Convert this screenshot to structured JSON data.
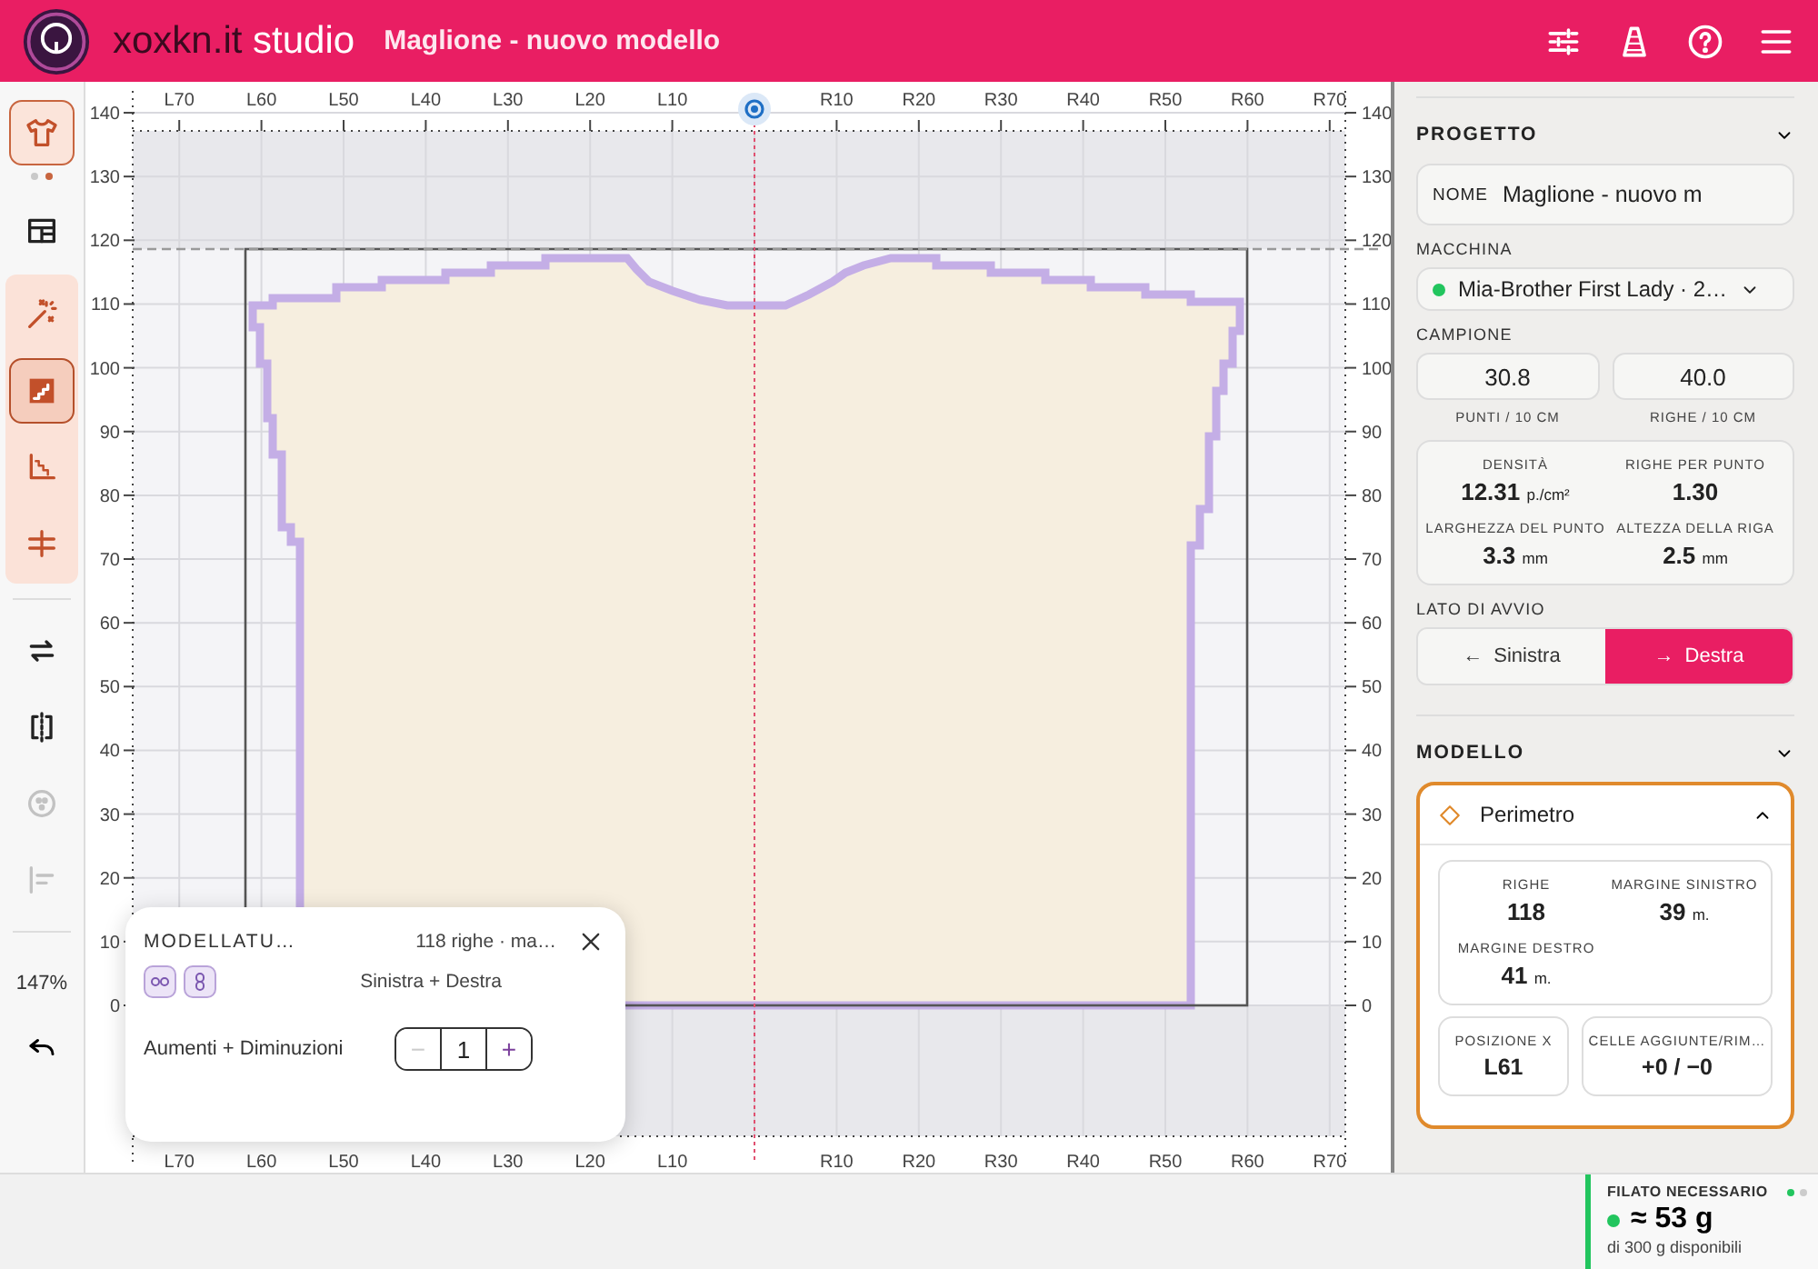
{
  "header": {
    "brand": "xoxkn.it",
    "brand_suffix": "studio",
    "title": "Maglione - nuovo modello"
  },
  "toolbar": {
    "groups": [
      {
        "kind": "group",
        "highlighted": false,
        "tools": [
          {
            "kind": "garment",
            "selected": true,
            "disabled": false
          }
        ],
        "pager": [
          {
            "selected": false
          },
          {
            "selected": true
          }
        ]
      },
      {
        "kind": "group",
        "highlighted": false,
        "tools": [
          {
            "kind": "layout",
            "selected": false,
            "disabled": false
          }
        ]
      },
      {
        "kind": "group",
        "highlighted": true,
        "tools": [
          {
            "kind": "wand",
            "selected": false,
            "disabled": false
          },
          {
            "kind": "stairs",
            "selected": true,
            "disabled": false
          },
          {
            "kind": "steps",
            "selected": false,
            "disabled": false
          },
          {
            "kind": "split",
            "selected": false,
            "disabled": false
          }
        ]
      },
      {
        "kind": "divider"
      },
      {
        "kind": "group",
        "highlighted": false,
        "tools": [
          {
            "kind": "swap",
            "selected": false,
            "disabled": false
          },
          {
            "kind": "mirror",
            "selected": false,
            "disabled": false
          },
          {
            "kind": "button",
            "selected": false,
            "disabled": true
          },
          {
            "kind": "align",
            "selected": false,
            "disabled": true
          }
        ]
      }
    ],
    "zoom": "147%"
  },
  "canvas": {
    "top_ruler": [
      "L70",
      "L60",
      "L50",
      "L40",
      "L30",
      "L20",
      "L10",
      "R10",
      "R20",
      "R30",
      "R40",
      "R50",
      "R60",
      "R70"
    ],
    "bottom_ruler": [
      "L70",
      "L60",
      "L50",
      "L40",
      "L30",
      "L20",
      "L10",
      "R10",
      "R20",
      "R30",
      "R40",
      "R50",
      "R60",
      "R70"
    ],
    "left_ruler": [
      "140",
      "130",
      "120",
      "110",
      "100",
      "90",
      "80",
      "70",
      "60",
      "50",
      "40",
      "30",
      "20",
      "10",
      "0"
    ],
    "right_ruler": [
      "140",
      "130",
      "120",
      "110",
      "100",
      "90",
      "80",
      "70",
      "60",
      "50",
      "40",
      "30",
      "20",
      "10",
      "0"
    ]
  },
  "popup": {
    "title": "MODELLATU…",
    "summary": "118 righe · ma…",
    "side": "Sinistra + Destra",
    "label": "Aumenti + Diminuzioni",
    "stepper": {
      "minus": "−",
      "value": "1",
      "plus": "+",
      "minus_disabled": true
    }
  },
  "project": {
    "heading": "PROGETTO",
    "expanded": true,
    "name_label": "NOME",
    "name_value": "Maglione - nuovo m",
    "machine_label": "MACCHINA",
    "machine": "Mia-Brother First Lady · 2…",
    "machine_online": true,
    "sample_label": "CAMPIONE",
    "gauge": [
      {
        "value": "30.8",
        "unit": "PUNTI / 10 CM"
      },
      {
        "value": "40.0",
        "unit": "RIGHE / 10 CM"
      }
    ],
    "stats": [
      {
        "label": "DENSITÀ",
        "value": "12.31",
        "unit": "p./cm²"
      },
      {
        "label": "RIGHE PER PUNTO",
        "value": "1.30"
      },
      {
        "label": "LARGHEZZA DEL PUNTO",
        "value": "3.3",
        "unit": "mm"
      },
      {
        "label": "ALTEZZA DELLA RIGA",
        "value": "2.5",
        "unit": "mm"
      }
    ],
    "start_side_label": "LATO DI AVVIO",
    "start_side": [
      {
        "icon": "←",
        "label": "Sinistra",
        "selected": false
      },
      {
        "icon": "→",
        "label": "Destra",
        "selected": true
      }
    ]
  },
  "model": {
    "heading": "MODELLO",
    "expanded": true,
    "item": {
      "title": "Perimetro",
      "expanded": true,
      "stats": [
        {
          "label": "RIGHE",
          "value": "118"
        },
        {
          "label": "MARGINE SINISTRO",
          "value": "39",
          "unit": "m."
        },
        {
          "label": "MARGINE DESTRO",
          "value": "41",
          "unit": "m."
        }
      ],
      "cards": [
        {
          "label": "POSIZIONE X",
          "value": "L61"
        },
        {
          "label": "CELLE AGGIUNTE/RIM…",
          "value": "+0 / −0"
        }
      ]
    }
  },
  "yarn": {
    "label": "FILATO NECESSARIO",
    "pager": [
      {
        "selected": true
      },
      {
        "selected": false
      }
    ],
    "ok": true,
    "value": "≈ 53 g",
    "note": "di 300 g disponibili"
  }
}
